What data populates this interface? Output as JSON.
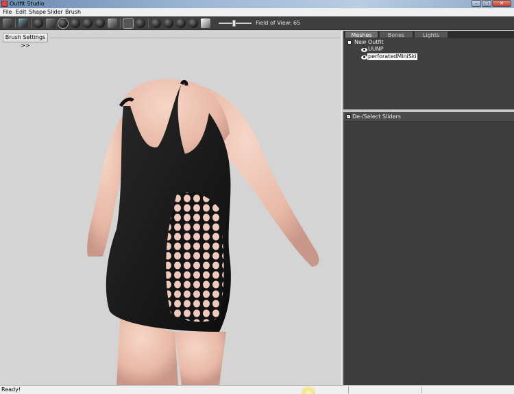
{
  "window": {
    "title": "Outfit Studio"
  },
  "menu": {
    "items": [
      "File",
      "Edit",
      "Shape",
      "Slider",
      "Brush"
    ]
  },
  "toolbar": {
    "fov_label": "Field of View: 65",
    "fov_value": 65
  },
  "viewport": {
    "brush_settings_label": "Brush Settings >>"
  },
  "panel": {
    "tabs": [
      "Meshes",
      "Bones",
      "Lights"
    ],
    "active_tab": "Meshes",
    "tree": {
      "root": "New Outfit",
      "meshes": [
        "UUNP",
        "perforatedMiniSki"
      ],
      "selected": "perforatedMiniSki"
    },
    "sliders_header": "De-/Select Sliders"
  },
  "status": {
    "text": "Ready!"
  },
  "colors": {
    "toolbar_bg": "#3f3f3f",
    "viewport_bg": "#d4d4d4",
    "panel_bg": "#3f3f3f"
  }
}
